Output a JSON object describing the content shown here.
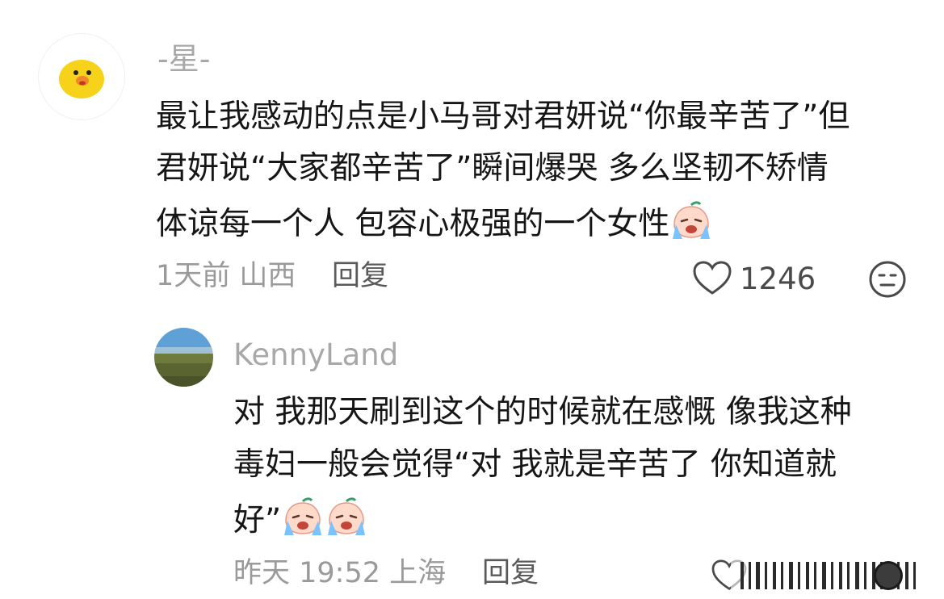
{
  "comment": {
    "username": "-星-",
    "lines": [
      "最让我感动的点是小马哥对君妍说“你最辛苦了”但",
      "君妍说“大家都辛苦了”瞬间爆哭 多么坚韧不矫情",
      "体谅每一个人 包容心极强的一个女性"
    ],
    "meta": "1天前 山西",
    "reply_label": "回复",
    "like_count": "1246",
    "avatar_icon": "cartoon-duck-icon",
    "emoji_icon": "crying-peach-emoji"
  },
  "reply": {
    "username": "KennyLand",
    "lines": [
      "对 我那天刷到这个的时候就在感慨 像我这种",
      "毒妇一般会觉得“对 我就是辛苦了 你知道就",
      "好”"
    ],
    "meta": "昨天 19:52 上海",
    "reply_label": "回复",
    "emoji_icon": "crying-peach-emoji"
  },
  "colors": {
    "text": "#161616",
    "muted": "#9a9a9a",
    "duck_yellow": "#f7d21a"
  }
}
